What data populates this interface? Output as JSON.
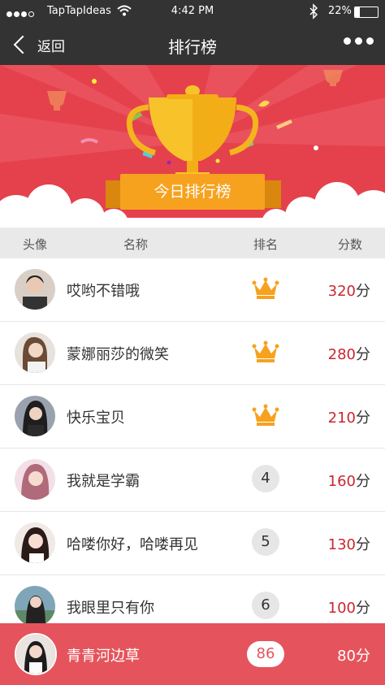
{
  "status": {
    "carrier": "TapTapIdeas",
    "time": "4:42 PM",
    "battery": "22%"
  },
  "nav": {
    "back_label": "返回",
    "title": "排行榜"
  },
  "banner": {
    "ribbon_label": "今日排行榜"
  },
  "table": {
    "headers": [
      "头像",
      "名称",
      "排名",
      "分数"
    ],
    "rows": [
      {
        "name": "哎哟不错哦",
        "rank": "crown",
        "score": "320",
        "unit": "分"
      },
      {
        "name": "蒙娜丽莎的微笑",
        "rank": "crown",
        "score": "280",
        "unit": "分"
      },
      {
        "name": "快乐宝贝",
        "rank": "crown",
        "score": "210",
        "unit": "分"
      },
      {
        "name": "我就是学霸",
        "rank": "4",
        "score": "160",
        "unit": "分"
      },
      {
        "name": "哈喽你好，哈喽再见",
        "rank": "5",
        "score": "130",
        "unit": "分"
      },
      {
        "name": "我眼里只有你",
        "rank": "6",
        "score": "100",
        "unit": "分"
      }
    ]
  },
  "me": {
    "name": "青青河边草",
    "rank": "86",
    "score": "80分"
  }
}
